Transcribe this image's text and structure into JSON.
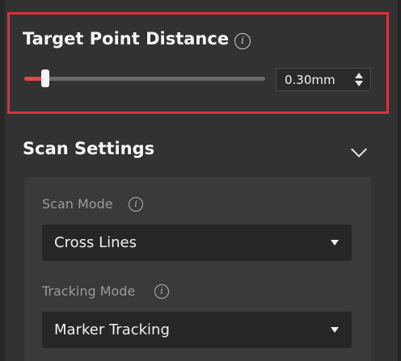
{
  "target_point_distance": {
    "title": "Target Point Distance",
    "info_icon": "info-icon",
    "slider_fraction": 0.1,
    "value": "0.30mm",
    "accent_color": "#e0474d",
    "highlight_color": "#d8333b"
  },
  "scan_settings": {
    "title": "Scan Settings",
    "collapse_icon": "chevron-down-icon",
    "scan_mode": {
      "label": "Scan Mode",
      "selected": "Cross Lines"
    },
    "tracking_mode": {
      "label": "Tracking Mode",
      "selected": "Marker Tracking"
    }
  }
}
